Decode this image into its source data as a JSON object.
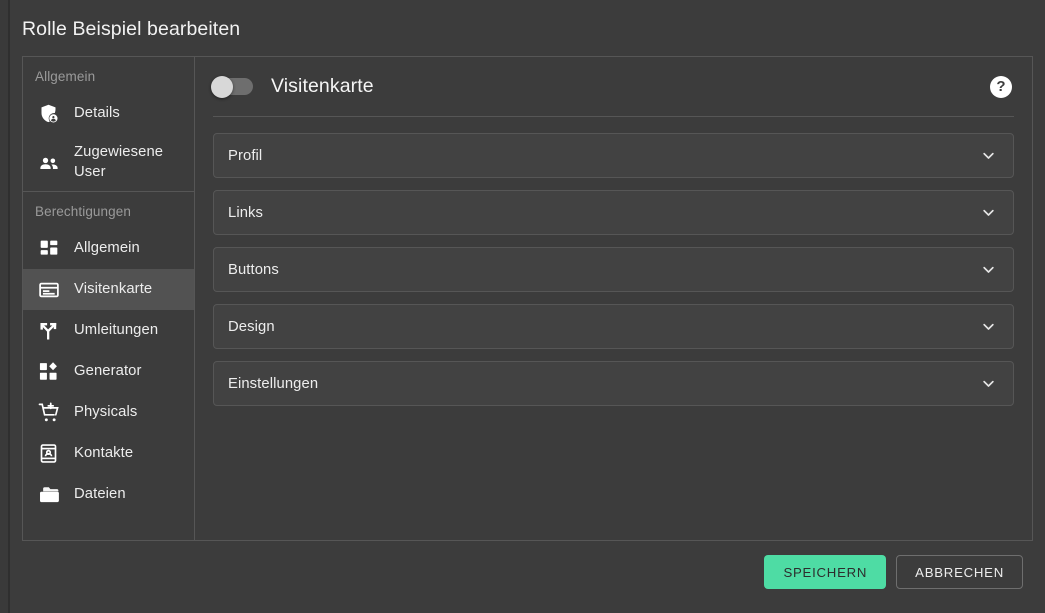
{
  "dialog": {
    "title": "Rolle Beispiel bearbeiten"
  },
  "sidebar": {
    "groups": [
      {
        "title": "Allgemein",
        "items": [
          {
            "label": "Details",
            "icon": "shield-user-icon",
            "active": false
          },
          {
            "label": "Zugewiesene User",
            "icon": "users-icon",
            "active": false
          }
        ]
      },
      {
        "title": "Berechtigungen",
        "items": [
          {
            "label": "Allgemein",
            "icon": "dashboard-icon",
            "active": false
          },
          {
            "label": "Visitenkarte",
            "icon": "id-card-icon",
            "active": true
          },
          {
            "label": "Umleitungen",
            "icon": "fork-arrow-icon",
            "active": false
          },
          {
            "label": "Generator",
            "icon": "generator-grid-icon",
            "active": false
          },
          {
            "label": "Physicals",
            "icon": "cart-plus-icon",
            "active": false
          },
          {
            "label": "Kontakte",
            "icon": "contact-card-icon",
            "active": false
          },
          {
            "label": "Dateien",
            "icon": "folder-icon",
            "active": false
          }
        ]
      }
    ]
  },
  "panel": {
    "title": "Visitenkarte",
    "toggle_enabled": false,
    "help_icon": "question-mark-icon",
    "sections": [
      {
        "label": "Profil",
        "icon": "chevron-down-icon"
      },
      {
        "label": "Links",
        "icon": "chevron-down-icon"
      },
      {
        "label": "Buttons",
        "icon": "chevron-down-icon"
      },
      {
        "label": "Design",
        "icon": "chevron-down-icon"
      },
      {
        "label": "Einstellungen",
        "icon": "chevron-down-icon"
      }
    ]
  },
  "footer": {
    "save_label": "SPEICHERN",
    "cancel_label": "ABBRECHEN"
  },
  "colors": {
    "accent_green": "#4edca4",
    "page_background": "#3a3a3a",
    "panel_background": "#3c3c3c",
    "row_background": "#424242",
    "active_item_background": "#525252",
    "border": "#565656"
  }
}
